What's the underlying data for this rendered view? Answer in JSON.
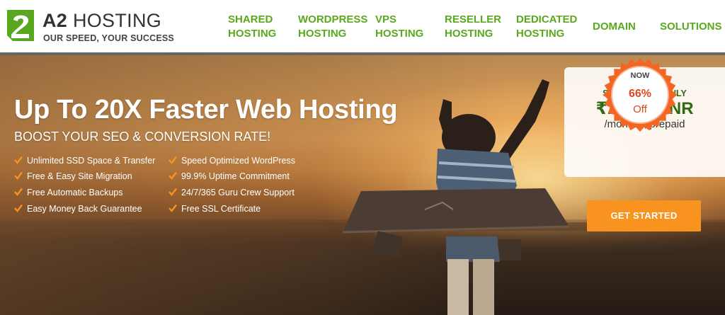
{
  "brand": {
    "name_bold": "A2",
    "name_rest": "HOSTING",
    "tagline": "OUR SPEED, YOUR SUCCESS",
    "logo_icon": "a2-logo-icon",
    "color_green": "#5aa81f"
  },
  "nav": {
    "items": [
      {
        "line1": "SHARED",
        "line2": "HOSTING"
      },
      {
        "line1": "WORDPRESS",
        "line2": "HOSTING"
      },
      {
        "line1": "VPS",
        "line2": "HOSTING"
      },
      {
        "line1": "RESELLER",
        "line2": "HOSTING"
      },
      {
        "line1": "DEDICATED",
        "line2": "HOSTING"
      },
      {
        "line1": "DOMAIN",
        "line2": ""
      },
      {
        "line1": "SOLUTIONS",
        "line2": ""
      }
    ]
  },
  "hero": {
    "title": "Up To 20X Faster Web Hosting",
    "subtitle": "BOOST YOUR SEO & CONVERSION RATE!",
    "features_left": [
      "Unlimited SSD Space & Transfer",
      "Free & Easy Site Migration",
      "Free Automatic Backups",
      "Easy Money Back Guarantee"
    ],
    "features_right": [
      "Speed Optimized WordPress",
      "99.9% Uptime Commitment",
      "24/7/365 Guru Crew Support",
      "Free SSL Certificate"
    ],
    "check_icon": "check-icon",
    "check_color": "#f7931e"
  },
  "offer": {
    "badge_now": "NOW",
    "badge_percent": "66%",
    "badge_off": "Off",
    "starting_label": "STARTING AT ONLY",
    "price": "₹221.99 INR",
    "period": "/monthly, prepaid",
    "cta_label": "GET STARTED",
    "cta_color": "#f7931e",
    "badge_color": "#f26522"
  }
}
